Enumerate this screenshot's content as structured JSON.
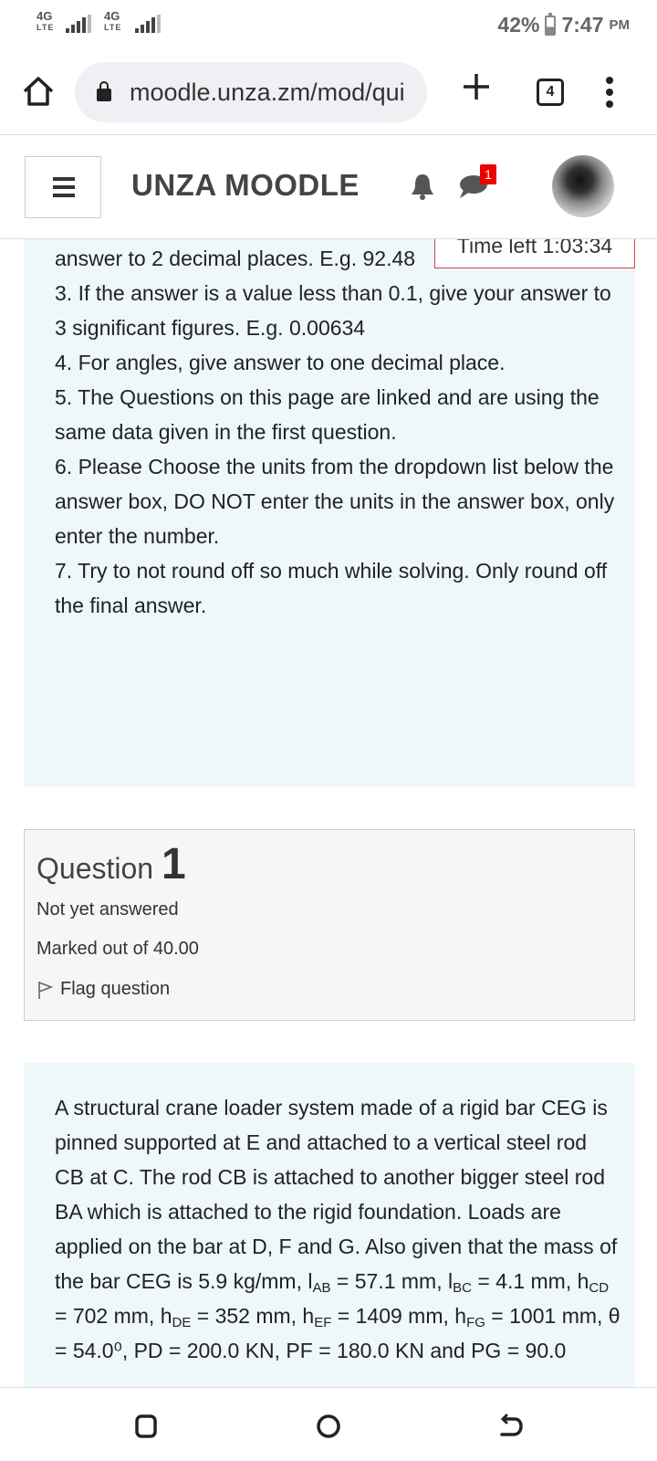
{
  "status_bar": {
    "sim1_network": "4G",
    "sim1_type": "LTE",
    "sim2_network": "4G",
    "sim2_type": "LTE",
    "battery_percent": "42%",
    "time": "7:47",
    "ampm": "PM"
  },
  "browser": {
    "url": "moodle.unza.zm/mod/qui",
    "tab_count": "4"
  },
  "header": {
    "site_name": "UNZA MOODLE",
    "message_badge": "1"
  },
  "quiz": {
    "timer": "Time left 1:03:34",
    "instructions": [
      "answer to 2 decimal places. E.g.  92.48",
      "3. If the answer is a value less than 0.1, give your answer to 3 significant figures. E.g.  0.00634",
      "4. For angles, give answer to one decimal place.",
      "5. The Questions on this page are linked and are using the same data given in the first question.",
      "6. Please Choose the units from the dropdown list below the answer box, DO NOT enter the units in the answer box, only enter the number.",
      "7. Try to not round off so much while solving. Only round off the final answer."
    ],
    "question": {
      "label": "Question",
      "number": "1",
      "state": "Not yet answered",
      "marks": "Marked out of 40.00",
      "flag_label": "Flag question",
      "text_intro": "A structural crane loader system made of a rigid bar CEG is pinned supported at E and attached to a vertical steel rod CB at C. The rod CB is attached to another bigger steel rod BA which is attached to the rigid foundation. Loads are applied on the bar at D, F and G. Also given that the mass of the bar CEG is 5.9 kg/mm,",
      "l_ab": "57.1 mm,",
      "l_bc": "4.1 mm,",
      "h_cd": "702 mm,",
      "h_de": "352 mm,",
      "h_ef": "1409 mm,",
      "h_fg": "1001 mm,",
      "theta": "θ =",
      "cut_line": "54.0⁰, PD = 200.0 KN, PF = 180.0 KN and PG = 90.0"
    }
  },
  "colors": {
    "panel_bg": "#eef7fa",
    "badge_red": "#e00000",
    "timer_border": "#cc4444"
  }
}
